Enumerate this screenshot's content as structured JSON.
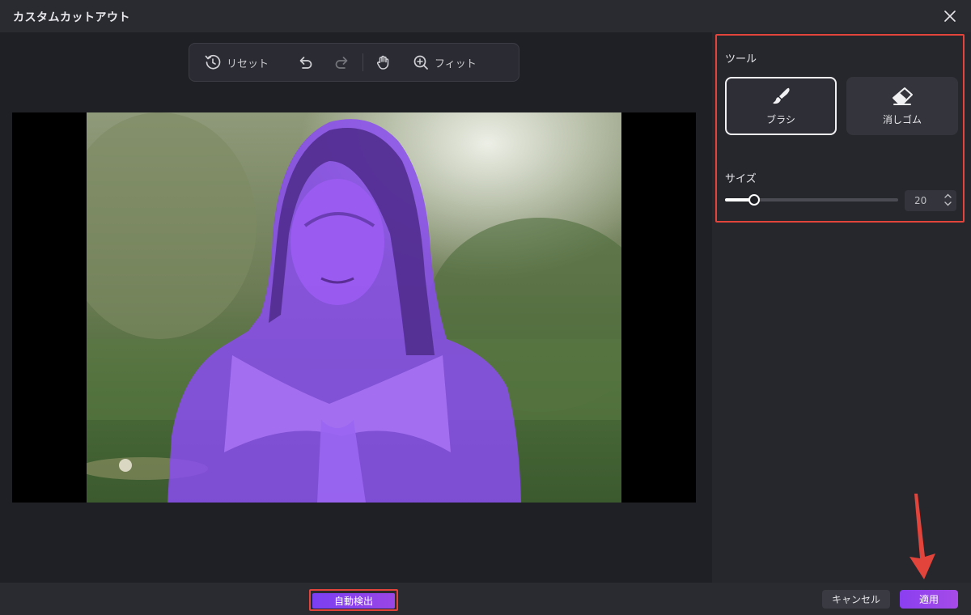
{
  "window": {
    "title": "カスタムカットアウト"
  },
  "toolbar": {
    "reset_label": "リセット",
    "fit_label": "フィット",
    "icons": [
      "reset-icon",
      "undo-icon",
      "redo-icon",
      "hand-icon",
      "zoom-in-icon"
    ]
  },
  "panel": {
    "tools_label": "ツール",
    "brush_label": "ブラシ",
    "eraser_label": "消しゴム",
    "active_tool": "brush",
    "size_label": "サイズ",
    "size_value": "20",
    "size_fraction": 0.17
  },
  "footer": {
    "auto_detect_label": "自動検出",
    "cancel_label": "キャンセル",
    "apply_label": "適用"
  },
  "colors": {
    "accent": "#8a3ff0",
    "mask": "#8f4ff0",
    "annotation": "#e2433a"
  }
}
